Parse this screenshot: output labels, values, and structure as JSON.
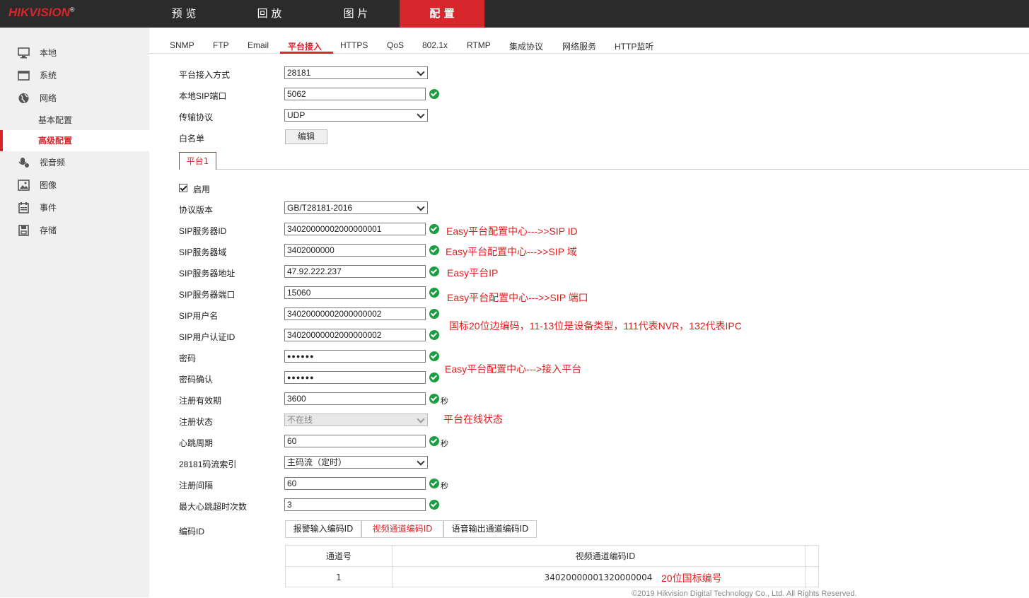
{
  "brand": {
    "logo": "HIKVISION",
    "reg": "®"
  },
  "nav": {
    "tabs": [
      "预 览",
      "回 放",
      "图 片",
      "配 置"
    ],
    "active_index": 3
  },
  "sidebar": {
    "items": [
      {
        "label": "本地",
        "icon": "monitor-icon"
      },
      {
        "label": "系统",
        "icon": "system-window-icon"
      },
      {
        "label": "网络",
        "icon": "globe-icon"
      },
      {
        "label": "视音频",
        "icon": "microphone-icon"
      },
      {
        "label": "图像",
        "icon": "image-icon"
      },
      {
        "label": "事件",
        "icon": "calendar-icon"
      },
      {
        "label": "存储",
        "icon": "storage-disk-icon"
      }
    ],
    "network_sub": [
      "基本配置",
      "高级配置"
    ],
    "active_sub": "高级配置"
  },
  "subtabs": {
    "items": [
      "SNMP",
      "FTP",
      "Email",
      "平台接入",
      "HTTPS",
      "QoS",
      "802.1x",
      "RTMP",
      "集成协议",
      "网络服务",
      "HTTP监听"
    ],
    "active": "平台接入"
  },
  "form": {
    "access_mode": {
      "label": "平台接入方式",
      "value": "28181"
    },
    "local_sip_port": {
      "label": "本地SIP端口",
      "value": "5062"
    },
    "transport": {
      "label": "传输协议",
      "value": "UDP"
    },
    "whitelist": {
      "label": "白名单",
      "button": "编辑"
    },
    "platform_tab": "平台1",
    "enable": {
      "label": "启用",
      "checked": true
    },
    "protocol_version": {
      "label": "协议版本",
      "value": "GB/T28181-2016"
    },
    "sip_server_id": {
      "label": "SIP服务器ID",
      "value": "34020000002000000001"
    },
    "sip_server_domain": {
      "label": "SIP服务器域",
      "value": "3402000000"
    },
    "sip_server_addr": {
      "label": "SIP服务器地址",
      "value": "47.92.222.237"
    },
    "sip_server_port": {
      "label": "SIP服务器端口",
      "value": "15060"
    },
    "sip_username": {
      "label": "SIP用户名",
      "value": "34020000002000000002"
    },
    "sip_auth_id": {
      "label": "SIP用户认证ID",
      "value": "34020000002000000002"
    },
    "password": {
      "label": "密码",
      "value": "●●●●●●"
    },
    "password_confirm": {
      "label": "密码确认",
      "value": "●●●●●●"
    },
    "reg_validity": {
      "label": "注册有效期",
      "value": "3600",
      "unit": "秒"
    },
    "reg_status": {
      "label": "注册状态",
      "value": "不在线"
    },
    "heartbeat": {
      "label": "心跳周期",
      "value": "60",
      "unit": "秒"
    },
    "stream_index": {
      "label": "28181码流索引",
      "value": "主码流（定时）"
    },
    "reg_interval": {
      "label": "注册间隔",
      "value": "60",
      "unit": "秒"
    },
    "max_heartbeat_timeout": {
      "label": "最大心跳超时次数",
      "value": "3"
    },
    "code_id": {
      "label": "编码ID",
      "tabs": [
        "报警输入编码ID",
        "视频通道编码ID",
        "语音输出通道编码ID"
      ],
      "active_tab": "视频通道编码ID"
    }
  },
  "table": {
    "headers": [
      "通道号",
      "视频通道编码ID"
    ],
    "rows": [
      {
        "channel": "1",
        "code": "34020000001320000004"
      }
    ]
  },
  "annotations": {
    "sip_id": "Easy平台配置中心--->>SIP ID",
    "sip_domain": "Easy平台配置中心--->>SIP 域",
    "ip": "Easy平台IP",
    "sip_port": "Easy平台配置中心--->>SIP 端口",
    "gb_code": "国标20位边编码，11-13位是设备类型，111代表NVR，132代表IPC",
    "access": "Easy平台配置中心--->接入平台",
    "status": "平台在线状态",
    "code20": "20位国标编号"
  },
  "footer": "©2019 Hikvision Digital Technology Co., Ltd. All Rights Reserved.",
  "colors": {
    "accent": "#d7262c",
    "ok": "#1a9e3f",
    "annotation": "#e02020",
    "topbar": "#2b2b2b"
  }
}
